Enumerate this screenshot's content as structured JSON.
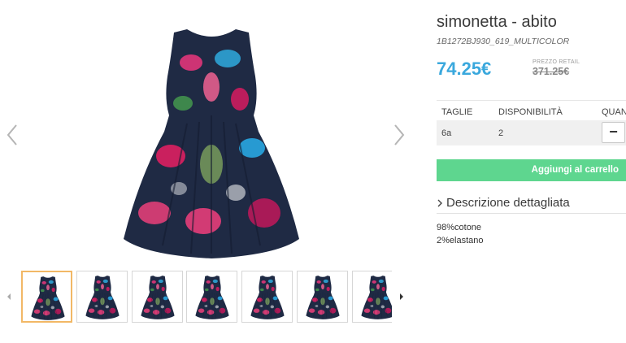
{
  "product": {
    "title": "simonetta - abito",
    "sku": "1B1272BJ930_619_MULTICOLOR",
    "price": "74.25€",
    "retail_label": "PREZZO RETAIL",
    "retail_price": "371.25€"
  },
  "availability_table": {
    "headers": [
      "TAGLIE",
      "DISPONIBILITÀ",
      "QUAN"
    ],
    "rows": [
      {
        "size": "6a",
        "availability": "2",
        "qty_button": "−"
      }
    ]
  },
  "cart_button": {
    "label": "Aggiungi al carrello"
  },
  "description": {
    "toggle_label": "Descrizione dettagliata",
    "materials": [
      "98%cotone",
      "2%elastano"
    ]
  },
  "gallery": {
    "thumbnail_count": 7,
    "active_thumbnail": 1,
    "icons": [
      "chevron-left-icon",
      "chevron-right-icon",
      "caret-left-icon",
      "caret-right-icon",
      "chevron-right-icon"
    ]
  },
  "colors": {
    "price": "#3aa8dd",
    "cart_button": "#5ed68f",
    "active_thumb_border": "#f2b866",
    "dress_base": "#1f2a44"
  }
}
